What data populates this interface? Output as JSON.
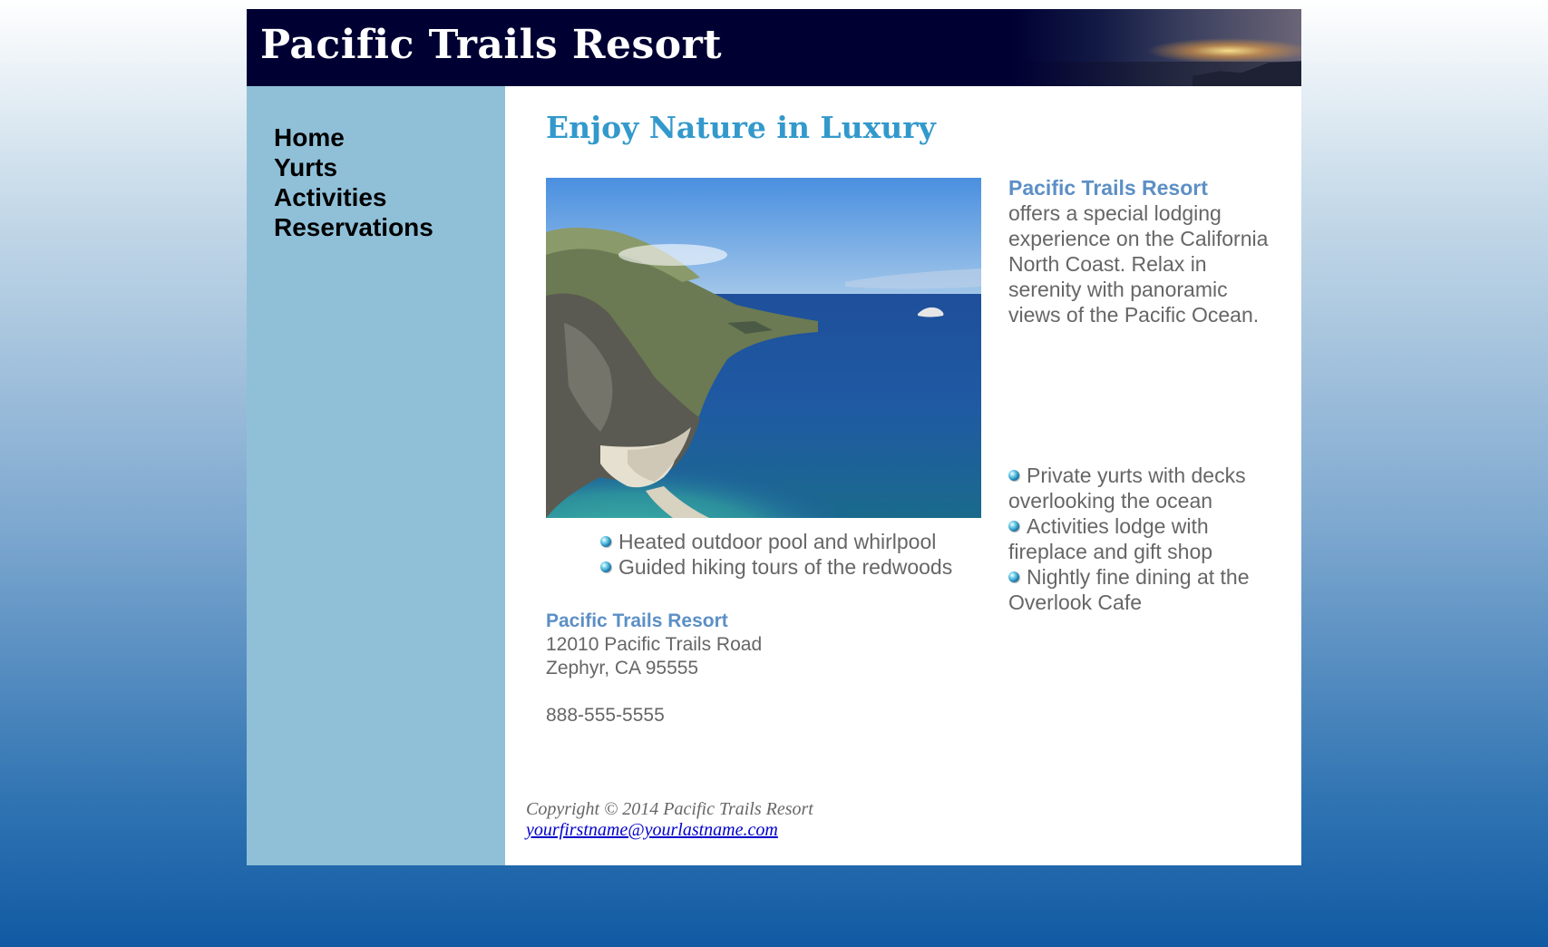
{
  "header": {
    "title": "Pacific Trails Resort"
  },
  "nav": {
    "items": [
      {
        "label": "Home"
      },
      {
        "label": "Yurts"
      },
      {
        "label": "Activities"
      },
      {
        "label": "Reservations"
      }
    ]
  },
  "main": {
    "heading": "Enjoy Nature in Luxury",
    "intro": {
      "name": "Pacific Trails Resort",
      "text": "offers a special lodging experience on the California North Coast. Relax in serenity with panoramic views of the Pacific Ocean."
    },
    "features_right": [
      "Private yurts with decks overlooking the ocean",
      "Activities lodge with fireplace and gift shop",
      "Nightly fine dining at the Overlook Cafe"
    ],
    "features_left": [
      "Heated outdoor pool and whirlpool",
      "Guided hiking tours of the redwoods"
    ],
    "address": {
      "name": "Pacific Trails Resort",
      "street": "12010 Pacific Trails Road",
      "city": "Zephyr, CA 95555",
      "phone": "888-555-5555"
    }
  },
  "footer": {
    "copyright": "Copyright © 2014 Pacific Trails Resort",
    "email": "yourfirstname@yourlastname.com"
  },
  "colors": {
    "header_bg": "#000033",
    "nav_bg": "#90c0d8",
    "heading": "#3399cc",
    "resort_name": "#5c8fc6",
    "body_text": "#666666",
    "link": "#0000cc"
  }
}
